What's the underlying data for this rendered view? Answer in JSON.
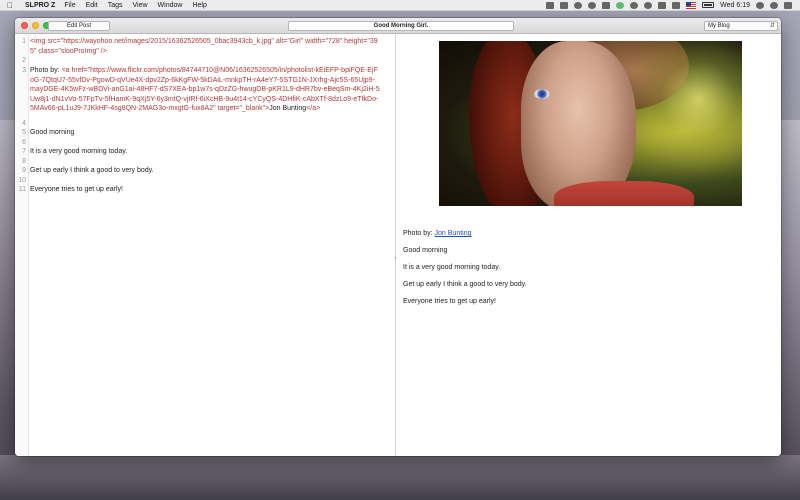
{
  "menubar": {
    "app_name": "SLPRO Z",
    "items": [
      "File",
      "Edit",
      "Tags",
      "View",
      "Window",
      "Help"
    ],
    "clock": "Wed 6:19"
  },
  "window": {
    "edit_post_label": "Edit Post",
    "title": "Good Morning Girl.",
    "blog_select": "My Blog"
  },
  "editor": {
    "lines": [
      {
        "n": "1",
        "segments": [
          {
            "cls": "t-tag",
            "text": "<img "
          },
          {
            "cls": "t-attr",
            "text": "src=\"https://wayohoo.net/images/2015/16362526505_0bac3943cb_k.jpg\" alt=\"Girl\" width=\"728\" height=\"395\" class=\"slooProImg\""
          },
          {
            "cls": "t-tag",
            "text": " />"
          }
        ]
      },
      {
        "n": "2",
        "segments": []
      },
      {
        "n": "3",
        "segments": [
          {
            "cls": "",
            "text": "Photo by: "
          },
          {
            "cls": "t-tag",
            "text": "<a "
          },
          {
            "cls": "t-attr",
            "text": "href=\"https://www.flickr.com/photos/84744710@N06/16362526505/in/photolist-kEiEFP-bpiFQE-EjFoG-7QtqU7-55vfDv-PgowD-qVUe4X-dpv2Zp-6kKgFW-5kDAiL-mnkpTH-rA4eY7-5STG1N-JXrhg-Ajc5S-65Ujp9-mayDGE-4K5wFz-wBDVi-anG1ai-48HF7-dS7XEA-bp1w7s-qDzZG-hwugDB-pKR1L9-dHR7bv-eBeqSm-4Kj2iH-5Uw8j1-dN1vVo-57FpTv-5fHamK-9qXj5Y-6y3mtQ-vjtRf-6iXcHB-9u4t14-cYCyQS-4DHfiK-cAbXTf-8dzLo9-eTfkDo-5MAv66-pL1uJ9-7JKkHF-4sg8QN-2MAG3o-mxgtG-fux8A2\" target=\"_blank\""
          },
          {
            "cls": "t-tag",
            "text": ">"
          },
          {
            "cls": "",
            "text": "Jon Bunting"
          },
          {
            "cls": "t-tag",
            "text": "</a>"
          }
        ]
      },
      {
        "n": "4",
        "segments": []
      },
      {
        "n": "5",
        "segments": [
          {
            "cls": "",
            "text": "Good morning"
          }
        ]
      },
      {
        "n": "6",
        "segments": []
      },
      {
        "n": "7",
        "segments": [
          {
            "cls": "",
            "text": "It is a very good morning today."
          }
        ]
      },
      {
        "n": "8",
        "segments": []
      },
      {
        "n": "9",
        "segments": [
          {
            "cls": "",
            "text": "Get up early I think a good to very body."
          }
        ]
      },
      {
        "n": "10",
        "segments": []
      },
      {
        "n": "11",
        "segments": [
          {
            "cls": "",
            "text": "Everyone tries to get up early!"
          }
        ]
      }
    ]
  },
  "preview": {
    "photo_credit_prefix": "Photo by: ",
    "photo_credit_link": "Jon Bunting",
    "paragraphs": [
      "Good morning",
      "It is a very good morning today.",
      "Get up early I think a good to very body.",
      "Everyone tries to get up early!"
    ]
  }
}
